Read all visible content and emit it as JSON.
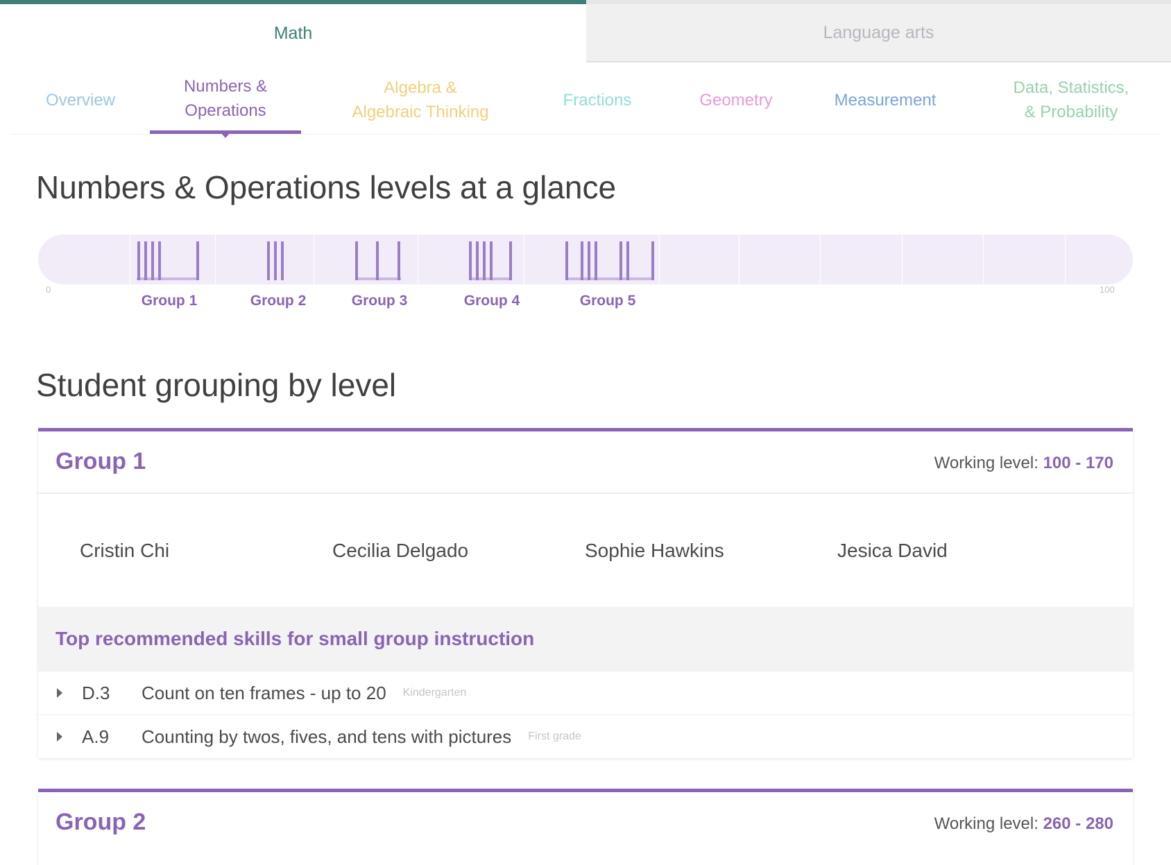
{
  "tabs": {
    "math": "Math",
    "language_arts": "Language arts"
  },
  "subtabs": [
    {
      "line1": "Overview",
      "line2": "",
      "color": "#9ec5e6"
    },
    {
      "line1": "Numbers &",
      "line2": "Operations",
      "color": "#8a64b4"
    },
    {
      "line1": "Algebra &",
      "line2": "Algebraic Thinking",
      "color": "#f3cf7c"
    },
    {
      "line1": "Fractions",
      "line2": "",
      "color": "#92ddd9"
    },
    {
      "line1": "Geometry",
      "line2": "",
      "color": "#e79bd5"
    },
    {
      "line1": "Measurement",
      "line2": "",
      "color": "#7ba4dc"
    },
    {
      "line1": "Data, Statistics,",
      "line2": "& Probability",
      "color": "#95d3a8"
    }
  ],
  "glance": {
    "title": "Numbers & Operations levels at a glance",
    "min_label": "0",
    "max_label": "100",
    "groups": [
      "Group 1",
      "Group 2",
      "Group 3",
      "Group 4",
      "Group 5"
    ]
  },
  "grouping": {
    "title": "Student grouping by level"
  },
  "group1": {
    "title": "Group 1",
    "working_label": "Working level: ",
    "working_range": "100 - 170",
    "students": [
      "Cristin Chi",
      "Cecilia Delgado",
      "Sophie Hawkins",
      "Jesica David"
    ],
    "rec_title": "Top recommended skills for small group instruction",
    "skills": [
      {
        "code": "D.3",
        "name": "Count on ten frames - up to 20",
        "grade": "Kindergarten"
      },
      {
        "code": "A.9",
        "name": "Counting by twos, fives, and tens with pictures",
        "grade": "First grade"
      }
    ]
  },
  "group2": {
    "title": "Group 2",
    "working_label": "Working level: ",
    "working_range": "260 - 280"
  },
  "colors": {
    "accent": "#8a64b4",
    "math_tab": "#3f7f79"
  }
}
